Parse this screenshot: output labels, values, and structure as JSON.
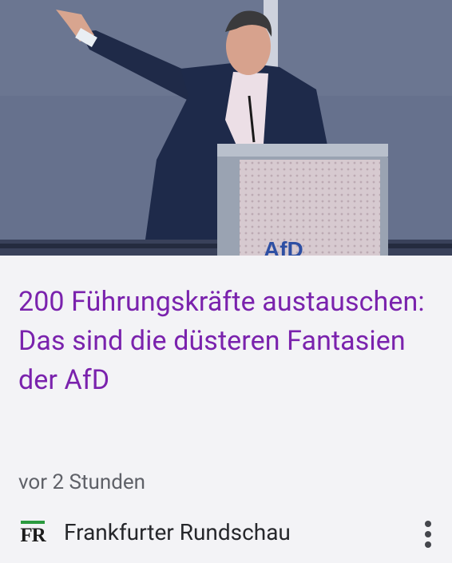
{
  "article": {
    "headline": "200 Führungskräfte austauschen: Das sind die düsteren Fantasien der AfD",
    "time": "vor 2 Stunden",
    "image_logo_text": "AfD"
  },
  "source": {
    "logo_text": "FR",
    "name": "Frankfurter Rundschau"
  },
  "icons": {
    "more": "more-vert-icon"
  },
  "colors": {
    "headline": "#7a22ad",
    "background": "#f3f3f6",
    "logo_accent": "#2b9a3f"
  }
}
